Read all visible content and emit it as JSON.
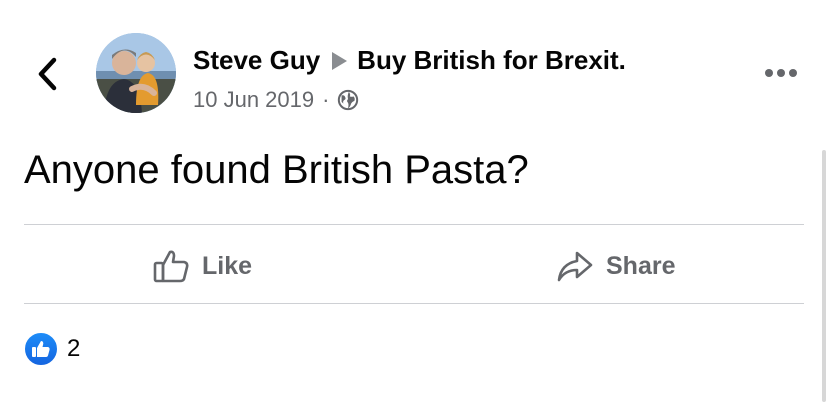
{
  "post": {
    "author": "Steve Guy",
    "group": "Buy British for Brexit.",
    "date": "10 Jun 2019",
    "separator": "·",
    "privacy_icon": "globe-icon",
    "text": "Anyone found British Pasta?"
  },
  "actions": {
    "like_label": "Like",
    "share_label": "Share"
  },
  "reactions": {
    "icon": "like-reaction-icon",
    "count": "2"
  },
  "colors": {
    "text_primary": "#050505",
    "text_secondary": "#65676b",
    "accent_blue": "#1877f2",
    "divider": "#ced0d4"
  }
}
